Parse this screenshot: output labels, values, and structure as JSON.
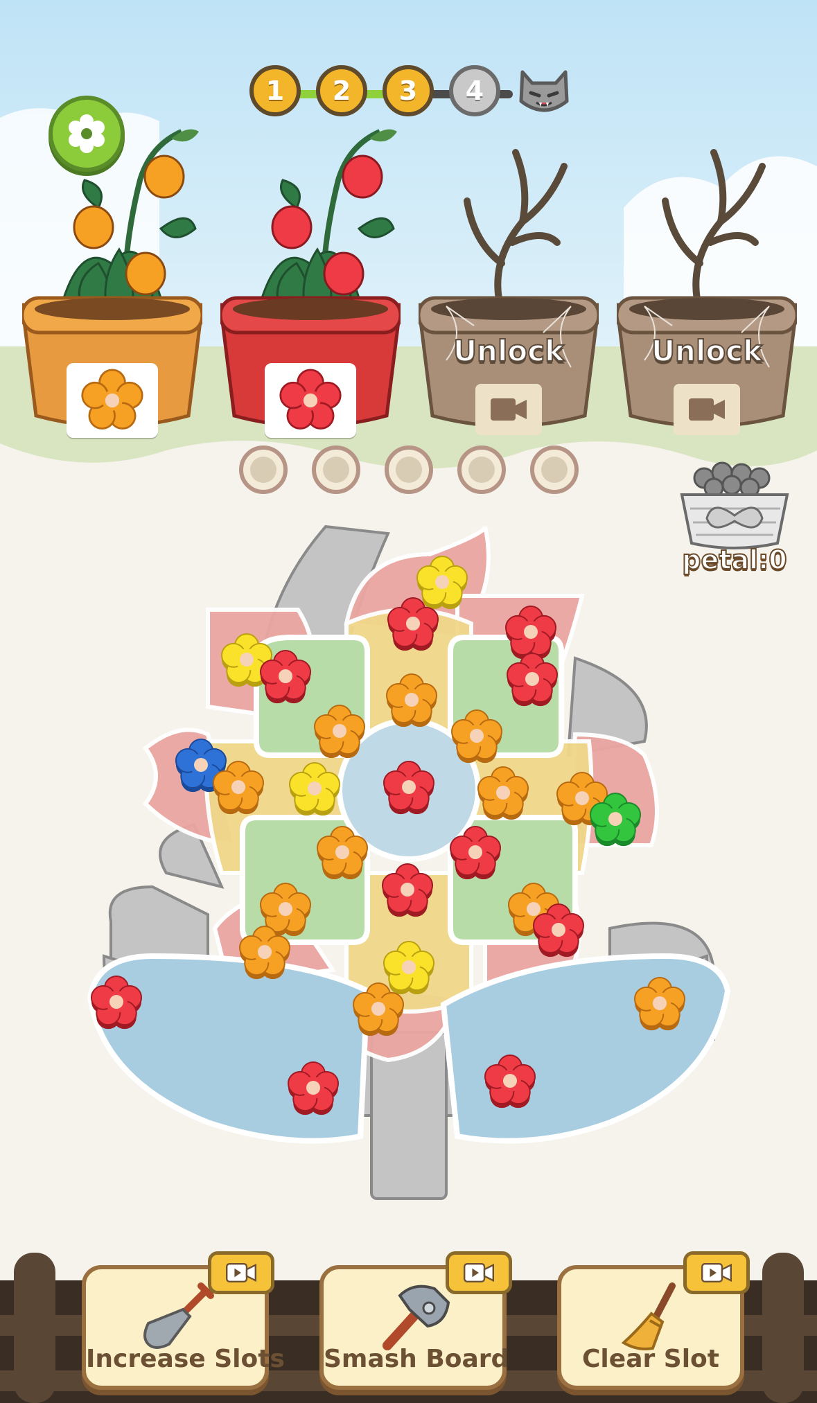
{
  "progress": {
    "levels": [
      "1",
      "2",
      "3",
      "4"
    ],
    "completed_count": 3,
    "boss_icon": "cat-boss-icon"
  },
  "settings": {
    "icon": "gear-icon"
  },
  "pots": [
    {
      "color": "orange",
      "locked": false,
      "flower_color": "#f7a124"
    },
    {
      "color": "red",
      "locked": false,
      "flower_color": "#ee3b46"
    },
    {
      "color": "brown",
      "locked": true,
      "label": "Unlock",
      "icon": "video-icon"
    },
    {
      "color": "brown",
      "locked": true,
      "label": "Unlock",
      "icon": "video-icon"
    }
  ],
  "slots": {
    "count": 5,
    "filled": 0
  },
  "petal_counter": {
    "label": "petal:0"
  },
  "board": {
    "flower_colors": {
      "red": "#ee3b46",
      "orange": "#f7a124",
      "yellow": "#fbe22a",
      "blue": "#2e72d8",
      "green": "#34c53e"
    }
  },
  "tools": [
    {
      "label": "Increase Slots",
      "icon": "shovel-icon",
      "badge_icon": "video-icon"
    },
    {
      "label": "Smash Board",
      "icon": "hammer-icon",
      "badge_icon": "video-icon"
    },
    {
      "label": "Clear Slot",
      "icon": "broom-icon",
      "badge_icon": "video-icon"
    }
  ],
  "colors": {
    "sky_top": "#cfe9f7",
    "grass": "#d7e3bf",
    "board_bg": "#f5f3ec",
    "button_fill": "#fbf0c8",
    "button_text": "#6b5033"
  }
}
